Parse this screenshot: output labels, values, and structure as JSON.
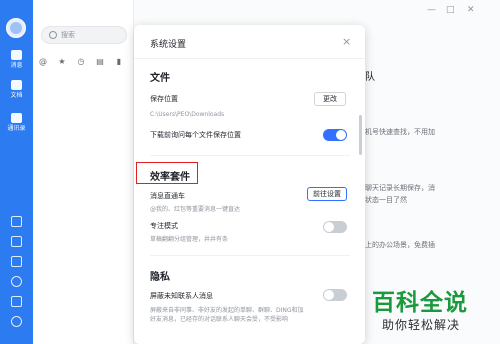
{
  "sidebar": {
    "items": [
      {
        "label": "消息",
        "icon": "chat-icon"
      },
      {
        "label": "文档",
        "icon": "document-icon"
      },
      {
        "label": "通讯录",
        "icon": "contacts-icon"
      }
    ],
    "bottom_icons": [
      "help-icon",
      "todo-icon",
      "lightning-icon",
      "phone-icon",
      "mail-icon",
      "settings-icon"
    ],
    "accent": "#2d7bf0"
  },
  "listpane": {
    "search_placeholder": "搜索",
    "filter_icons": [
      "at-icon",
      "star-icon",
      "clock-icon",
      "file-icon",
      "doc-icon"
    ]
  },
  "background": {
    "title_fragment": "队",
    "lines": [
      "机号快速查找，不用加",
      "聊天记录长期保存，消",
      "状态一目了然",
      "上的办公场景，免费插"
    ]
  },
  "modal": {
    "title": "系统设置",
    "close": "×",
    "sections": {
      "files": {
        "heading": "文件",
        "save_location_label": "保存位置",
        "save_location_path": "C:\\Users\\PEO\\Downloads",
        "change_button": "更改",
        "ask_each_time_label": "下载前询问每个文件保存位置",
        "ask_each_time_on": true
      },
      "efficiency": {
        "heading": "效率套件",
        "express_label": "消息直通车",
        "express_sub": "@我的、红包等重要消息一键直达",
        "express_button": "前往设置",
        "focus_label": "专注模式",
        "focus_sub": "草稿翻翻分组管理，井井有条",
        "focus_on": false
      },
      "privacy": {
        "heading": "隐私",
        "block_label": "屏蔽未知联系人消息",
        "block_sub_1": "屏蔽来自非同事、非好友的发起的单聊、群聊、DING和加",
        "block_sub_2": "好友消息，已经存的对话联系人聊天会受，不受影响",
        "block_on": false
      }
    },
    "accent": "#3370ff"
  },
  "watermark": {
    "big": "百科全说",
    "small": "助你轻松解决"
  },
  "highlight_color": "#e02020"
}
